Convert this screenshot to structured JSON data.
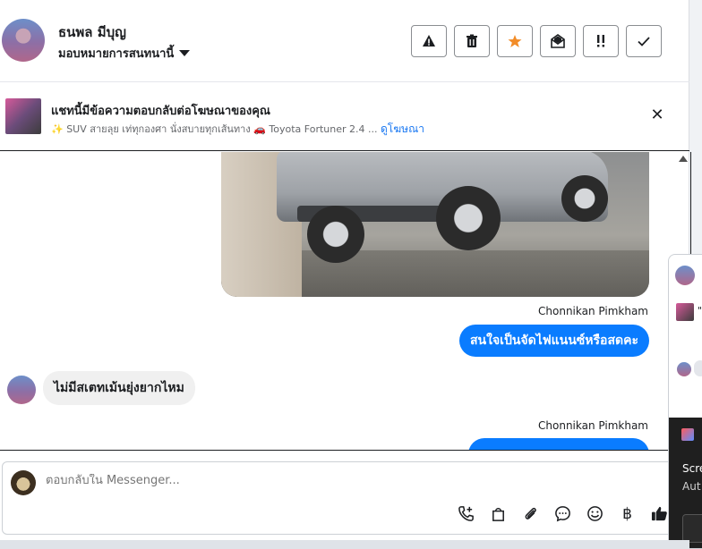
{
  "header": {
    "user_name": "ธนพล มีบุญ",
    "assign_label": "มอบหมายการสนทนานี้",
    "actions": [
      {
        "icon": "warning-icon",
        "glyph": "▲"
      },
      {
        "icon": "trash-icon",
        "glyph": "🗑"
      },
      {
        "icon": "star-icon",
        "glyph": "★"
      },
      {
        "icon": "open-envelope-icon",
        "glyph": "✉"
      },
      {
        "icon": "priority-icon",
        "glyph": "!!"
      },
      {
        "icon": "check-icon",
        "glyph": "✓"
      }
    ],
    "star_color": "#f28c28"
  },
  "banner": {
    "title": "แชทนี้มีข้อความตอบกลับต่อโฆษณาของคุณ",
    "subtitle": "✨ SUV สายลุย เท่ทุกองศา นั่งสบายทุกเส้นทาง 🚗 Toyota Fortuner 2.4 ...",
    "link": "ดูโฆษณา",
    "close_glyph": "✕"
  },
  "messages": [
    {
      "type": "sender",
      "text": "Chonnikan Pimkham"
    },
    {
      "type": "out",
      "text": "สนใจเป็นจัดไฟแนนซ์หรือสดคะ"
    },
    {
      "type": "in",
      "text": "ไม่มีสเตทเม้นยุ่งยากไหม"
    },
    {
      "type": "sender",
      "text": "Chonnikan Pimkham"
    }
  ],
  "composer": {
    "placeholder": "ตอบกลับใน Messenger..."
  },
  "tools": [
    {
      "icon": "call-add-icon",
      "glyph": "📞"
    },
    {
      "icon": "shopping-bag-icon",
      "glyph": "👜"
    },
    {
      "icon": "paperclip-icon",
      "glyph": "📎"
    },
    {
      "icon": "chat-bubble-icon",
      "glyph": "💬"
    },
    {
      "icon": "emoji-icon",
      "glyph": "☺"
    },
    {
      "icon": "baht-icon",
      "glyph": "฿"
    },
    {
      "icon": "thumbs-up-icon",
      "glyph": "👍"
    }
  ],
  "side": {
    "quote": "\"",
    "text1": "Scre",
    "text2": "Aut"
  },
  "colors": {
    "accent": "#0a7cff",
    "link": "#1877f2"
  }
}
